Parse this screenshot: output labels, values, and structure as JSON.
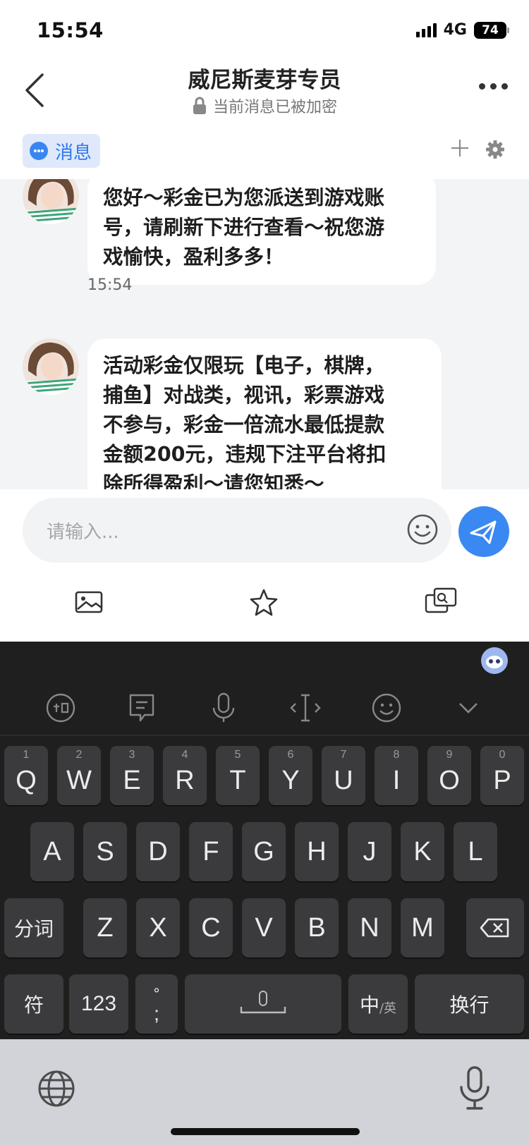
{
  "status_bar": {
    "time": "15:54",
    "network": "4G",
    "battery": "74"
  },
  "nav": {
    "title": "威尼斯麦芽专员",
    "subtitle": "当前消息已被加密"
  },
  "tabs": {
    "active_label": "消息"
  },
  "messages": [
    {
      "text_lines": [
        "您好～彩金已为您派送到游戏账",
        "号，请刷新下进行查看～祝您游",
        "戏愉快，盈利多多！"
      ],
      "time": "15:54"
    },
    {
      "text_lines": [
        "活动彩金仅限玩【电子，棋牌，",
        "捕鱼】对战类，视讯，彩票游戏",
        "不参与，彩金一倍流水最低提款",
        "金额200元，违规下注平台将扣",
        "除所得盈利～请您知悉～"
      ]
    }
  ],
  "composer": {
    "placeholder": "请输入..."
  },
  "keyboard": {
    "row1": [
      {
        "char": "Q",
        "num": "1"
      },
      {
        "char": "W",
        "num": "2"
      },
      {
        "char": "E",
        "num": "3"
      },
      {
        "char": "R",
        "num": "4"
      },
      {
        "char": "T",
        "num": "5"
      },
      {
        "char": "Y",
        "num": "6"
      },
      {
        "char": "U",
        "num": "7"
      },
      {
        "char": "I",
        "num": "8"
      },
      {
        "char": "O",
        "num": "9"
      },
      {
        "char": "P",
        "num": "0"
      }
    ],
    "row2": [
      "A",
      "S",
      "D",
      "F",
      "G",
      "H",
      "J",
      "K",
      "L"
    ],
    "row3": [
      "Z",
      "X",
      "C",
      "V",
      "B",
      "N",
      "M"
    ],
    "segment_label": "分词",
    "symbol_label": "符",
    "numbers_label": "123",
    "punct_top": "°",
    "punct_bottom": ";",
    "lang_main": "中",
    "lang_sub": "/英",
    "enter_label": "换行"
  },
  "colors": {
    "accent": "#3a88f1",
    "chat_bg": "#f3f4f6",
    "keyboard_bg": "#1f1f1f",
    "key_bg": "#3b3b3d"
  }
}
